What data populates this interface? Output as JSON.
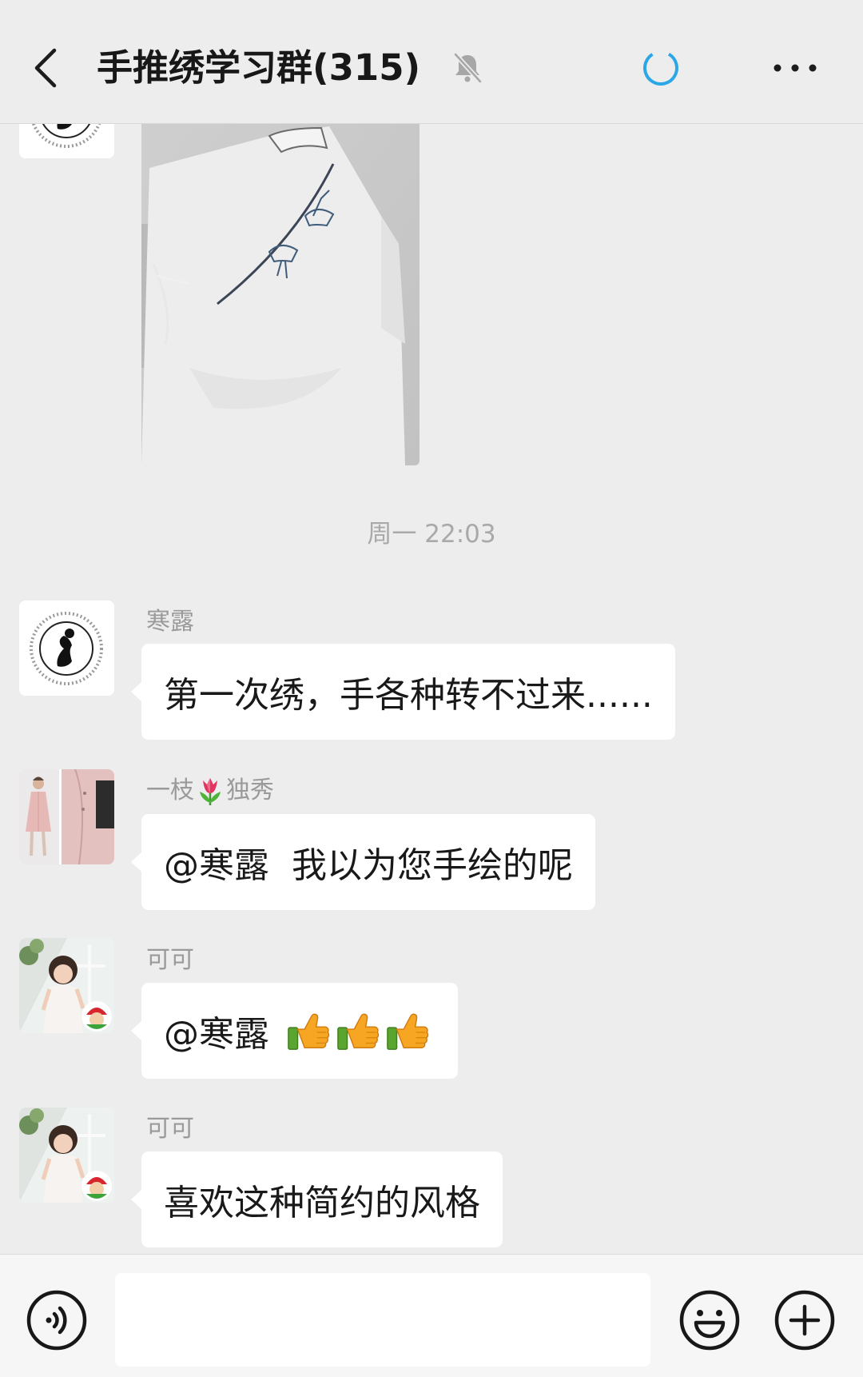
{
  "header": {
    "title": "手推绣学习群(315)",
    "back_icon": "chevron-left-icon",
    "mute_icon": "bell-muted-icon",
    "status_icon": "loading-spinner-icon",
    "more_icon": "more-dots-icon"
  },
  "timestamp": "周一 22:03",
  "messages": [
    {
      "type": "image",
      "avatar": "logo-avatar",
      "image": "embroidered-shirt-photo"
    },
    {
      "type": "text",
      "sender": "寒露",
      "avatar": "logo-avatar",
      "text": "第一次绣，手各种转不过来......"
    },
    {
      "type": "text",
      "sender_parts": [
        "一枝",
        "独秀"
      ],
      "sender_emoji": "tulip",
      "avatar": "pink-coat-avatar",
      "text": "@寒露  我以为您手绘的呢"
    },
    {
      "type": "text",
      "sender": "可可",
      "avatar": "girl-photo-avatar",
      "text": "@寒露",
      "emojis": [
        "thumbs-up",
        "thumbs-up",
        "thumbs-up"
      ]
    },
    {
      "type": "text",
      "sender": "可可",
      "avatar": "girl-photo-avatar",
      "text": "喜欢这种简约的风格"
    }
  ],
  "input_bar": {
    "voice_icon": "voice-icon",
    "input_value": "",
    "emoji_icon": "emoji-icon",
    "plus_icon": "plus-icon"
  },
  "colors": {
    "background": "#ededed",
    "bubble": "#ffffff",
    "accent": "#2ba6e6",
    "sender_name": "#9a9a9a",
    "timestamp": "#a9a9a9"
  }
}
